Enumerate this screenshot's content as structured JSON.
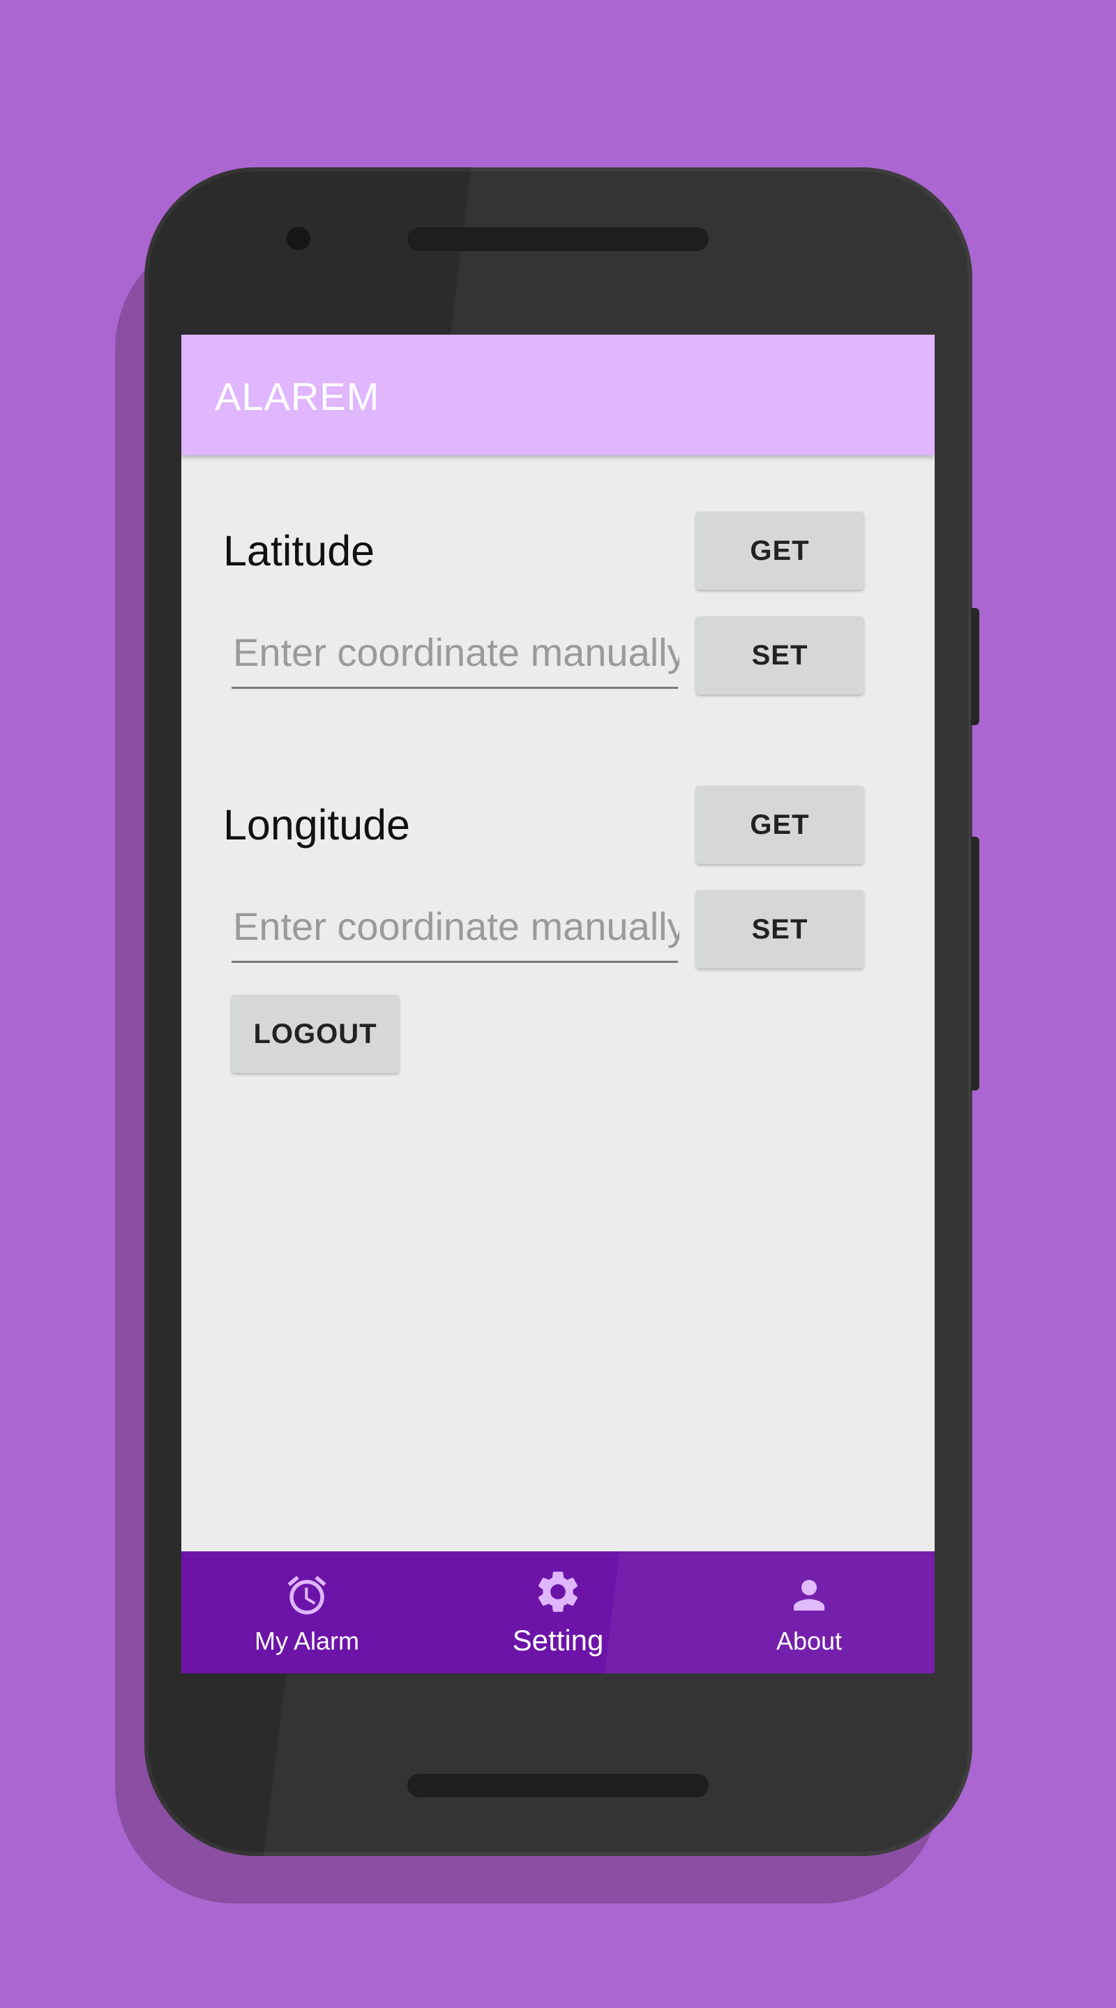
{
  "app": {
    "title": "ALAREM"
  },
  "latitude": {
    "label": "Latitude",
    "get_label": "GET",
    "set_label": "SET",
    "input_value": "",
    "input_placeholder": "Enter coordinate manually"
  },
  "longitude": {
    "label": "Longitude",
    "get_label": "GET",
    "set_label": "SET",
    "input_value": "",
    "input_placeholder": "Enter coordinate manually"
  },
  "logout_label": "LOGOUT",
  "bottom_nav": {
    "items": [
      {
        "label": "My Alarm",
        "icon": "alarm-clock-icon",
        "active": false
      },
      {
        "label": "Setting",
        "icon": "gear-icon",
        "active": true
      },
      {
        "label": "About",
        "icon": "person-icon",
        "active": false
      }
    ]
  },
  "colors": {
    "background": "#ab66d1",
    "appbar": "#e0b6fe",
    "bottom_nav": "#6d14a8",
    "nav_icon_inactive": "#e0b6fe",
    "nav_icon_active": "#e0b6fe",
    "screen_bg": "#ececec",
    "button_bg": "#d6d7d7"
  }
}
